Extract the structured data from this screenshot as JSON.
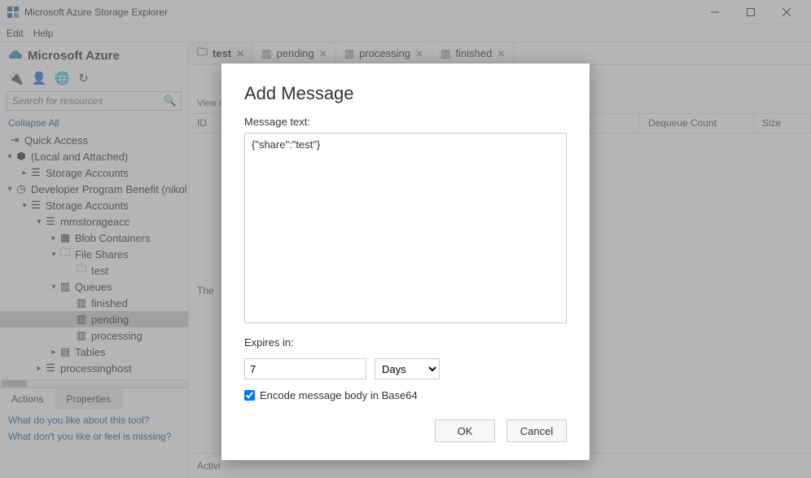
{
  "titlebar": {
    "title": "Microsoft Azure Storage Explorer"
  },
  "menubar": {
    "edit": "Edit",
    "help": "Help"
  },
  "brand": {
    "name": "Microsoft Azure"
  },
  "search": {
    "placeholder": "Search for resources"
  },
  "collapse_all": "Collapse All",
  "tree": {
    "quick_access": "Quick Access",
    "local": "(Local and Attached)",
    "storage_accounts_1": "Storage Accounts",
    "dev_benefit": "Developer Program Benefit (nikol",
    "storage_accounts_2": "Storage Accounts",
    "mmstorageacc": "mmstorageacc",
    "blob": "Blob Containers",
    "file_shares": "File Shares",
    "fs_test": "test",
    "queues": "Queues",
    "q_finished": "finished",
    "q_pending": "pending",
    "q_processing": "processing",
    "tables": "Tables",
    "processinghost": "processinghost"
  },
  "bottom_tabs": {
    "actions": "Actions",
    "properties": "Properties"
  },
  "feedback": {
    "line1": "What do you like about this tool?",
    "line2": "What don't you like or feel is missing?"
  },
  "tabs": [
    {
      "label": "test",
      "active": true
    },
    {
      "label": "pending",
      "active": false
    },
    {
      "label": "processing",
      "active": false
    },
    {
      "label": "finished",
      "active": false
    }
  ],
  "toolbar_hint": "View a",
  "columns": {
    "id": "ID",
    "dequeue": "Dequeue Count",
    "size": "Size"
  },
  "empty_text": "The",
  "activity_label": "Activi",
  "modal": {
    "title": "Add Message",
    "msg_label": "Message text:",
    "msg_value": "{\"share\":\"test\"}",
    "expires_label": "Expires in:",
    "expires_value": "7",
    "expires_unit": "Days",
    "encode_label": "Encode message body in Base64",
    "ok": "OK",
    "cancel": "Cancel"
  }
}
